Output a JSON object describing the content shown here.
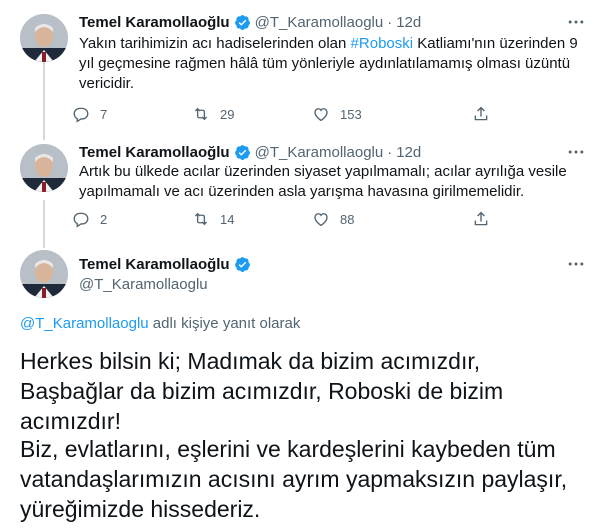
{
  "tweets": [
    {
      "name": "Temel Karamollaoğlu",
      "handle": "@T_Karamollaoglu",
      "dot": "·",
      "time": "12d",
      "text_before": "Yakın tarihimizin acı hadiselerinden olan ",
      "hashtag": "#Roboski",
      "text_after": " Katliamı'nın üzerinden 9 yıl geçmesine rağmen hâlâ tüm yönleriyle aydınlatılamamış olması üzüntü vericidir.",
      "replies": "7",
      "retweets": "29",
      "likes": "153"
    },
    {
      "name": "Temel Karamollaoğlu",
      "handle": "@T_Karamollaoglu",
      "dot": "·",
      "time": "12d",
      "text": "Artık bu ülkede acılar üzerinden siyaset yapılmamalı; acılar ayrılığa vesile yapılmamalı ve acı üzerinden asla yarışma havasına girilmemelidir.",
      "replies": "2",
      "retweets": "14",
      "likes": "88"
    }
  ],
  "main_tweet": {
    "name": "Temel Karamollaoğlu",
    "handle": "@T_Karamollaoglu",
    "replying_mention": "@T_Karamollaoglu",
    "replying_suffix": " adlı kişiye yanıt olarak",
    "paragraph1": "Herkes bilsin ki; Madımak da bizim acımızdır, Başbağlar da bizim acımızdır, Roboski de bizim acımızdır!",
    "paragraph2": "Biz, evlatlarını, eşlerini ve kardeşlerini kaybeden tüm vatandaşlarımızın acısını ayrım yapmaksızın paylaşır, yüreğimizde hissederiz."
  },
  "icons": {
    "verified": "verified-badge-icon",
    "more": "more-options-icon",
    "reply": "reply-icon",
    "retweet": "retweet-icon",
    "like": "heart-icon",
    "share": "share-icon"
  },
  "colors": {
    "accent": "#1d9bf0",
    "text": "#0f1419",
    "secondary": "#536471",
    "thread_line": "#cfd9de"
  }
}
